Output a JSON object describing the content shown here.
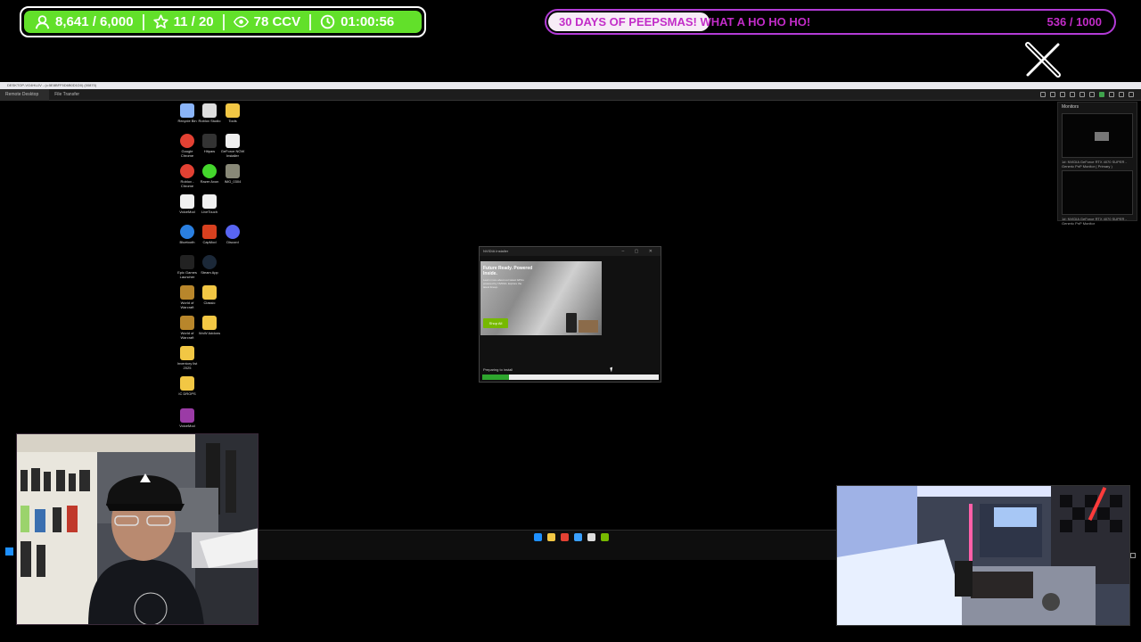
{
  "overlay": {
    "stats": {
      "followers": "8,641 / 6,000",
      "subs": "11 / 20",
      "viewers": "78 CCV",
      "uptime": "01:00:56",
      "accent": "#62e02a"
    },
    "goal": {
      "title": "30 DAYS OF PEEPSMAS! WHAT A HO HO HO!",
      "count": "536 / 1000",
      "progress": 0.536,
      "accent": "#b23bd6",
      "text_color": "#c22cc8"
    },
    "social_icon": "x-logo-icon"
  },
  "remote_desktop": {
    "title": "DESKTOP-VG4HUJV - (c:5E8BFF5D6B0D1D0) (00870)",
    "tabs": [
      "Remote Desktop",
      "File Transfer"
    ],
    "monitors": {
      "header": "Monitors",
      "items": [
        "1#: NVIDIA GeForce RTX 4070 SUPER - Generic PnP Monitor ( Primary )",
        "1#: NVIDIA GeForce RTX 4070 SUPER - Generic PnP Monitor"
      ]
    },
    "desktop_icons": [
      {
        "label": "Recycle Bin",
        "icon": "recycle-bin-icon",
        "color": "#8ab4f8"
      },
      {
        "label": "Roblox Studio",
        "icon": "roblox-icon",
        "color": "#dddddd"
      },
      {
        "label": "Tools",
        "icon": "folder-icon",
        "color": "#f2c744"
      },
      {
        "label": "Google Chrome",
        "icon": "chrome-icon",
        "color": "#e34133"
      },
      {
        "label": "Hitpaw",
        "icon": "app-icon",
        "color": "#333333"
      },
      {
        "label": "GeForce NOW Installer",
        "icon": "file-icon",
        "color": "#eeeeee"
      },
      {
        "label": "Roblox - Chrome",
        "icon": "chrome-icon",
        "color": "#e34133"
      },
      {
        "label": "Razer Axon",
        "icon": "razer-icon",
        "color": "#44d62c"
      },
      {
        "label": "IMG_0304",
        "icon": "image-icon",
        "color": "#888877"
      },
      {
        "label": "VoiceMod",
        "icon": "file-icon",
        "color": "#f0f0f0"
      },
      {
        "label": "LiveTouch",
        "icon": "app-icon",
        "color": "#f0f0f0"
      },
      {
        "label": "Bluetooth",
        "icon": "bluetooth-icon",
        "color": "#2a7fe0"
      },
      {
        "label": "CapMod",
        "icon": "app-icon",
        "color": "#d7401f"
      },
      {
        "label": "Discord",
        "icon": "discord-icon",
        "color": "#5865f2"
      },
      {
        "label": "Epic Games Launcher",
        "icon": "epic-icon",
        "color": "#222222"
      },
      {
        "label": "Steam App",
        "icon": "steam-icon",
        "color": "#1b2838"
      },
      {
        "label": "World of Warcraft",
        "icon": "wow-icon",
        "color": "#b8862b"
      },
      {
        "label": "Classic",
        "icon": "folder-icon",
        "color": "#f2c744"
      },
      {
        "label": "World of Warcraft",
        "icon": "wow-icon",
        "color": "#b8862b"
      },
      {
        "label": "WoW Addons",
        "icon": "folder-icon",
        "color": "#f2c744"
      },
      {
        "label": "Inventory list 2025",
        "icon": "folder-icon",
        "color": "#f2c744"
      },
      {
        "label": "IC DROPS",
        "icon": "folder-icon",
        "color": "#f2c744"
      },
      {
        "label": "VoiceMod",
        "icon": "app-icon",
        "color": "#9b3ba6"
      }
    ],
    "installer": {
      "title": "NVIDIA Installer",
      "headline": "Future Ready. Powered Inside.",
      "subtext": "Learn more about our latest GPUs powered by NVIDIA. Explore the latest lineup.",
      "cta": "Shop All",
      "status": "Preparing to install",
      "progress": 0.15
    },
    "taskbar_icons": [
      {
        "icon": "windows-start-icon",
        "color": "#1e90ff"
      },
      {
        "icon": "file-explorer-icon",
        "color": "#f2c744"
      },
      {
        "icon": "chrome-icon",
        "color": "#e34133"
      },
      {
        "icon": "settings-icon",
        "color": "#3aa0ff"
      },
      {
        "icon": "terminal-icon",
        "color": "#dddddd"
      },
      {
        "icon": "nvidia-icon",
        "color": "#76b900"
      }
    ]
  }
}
